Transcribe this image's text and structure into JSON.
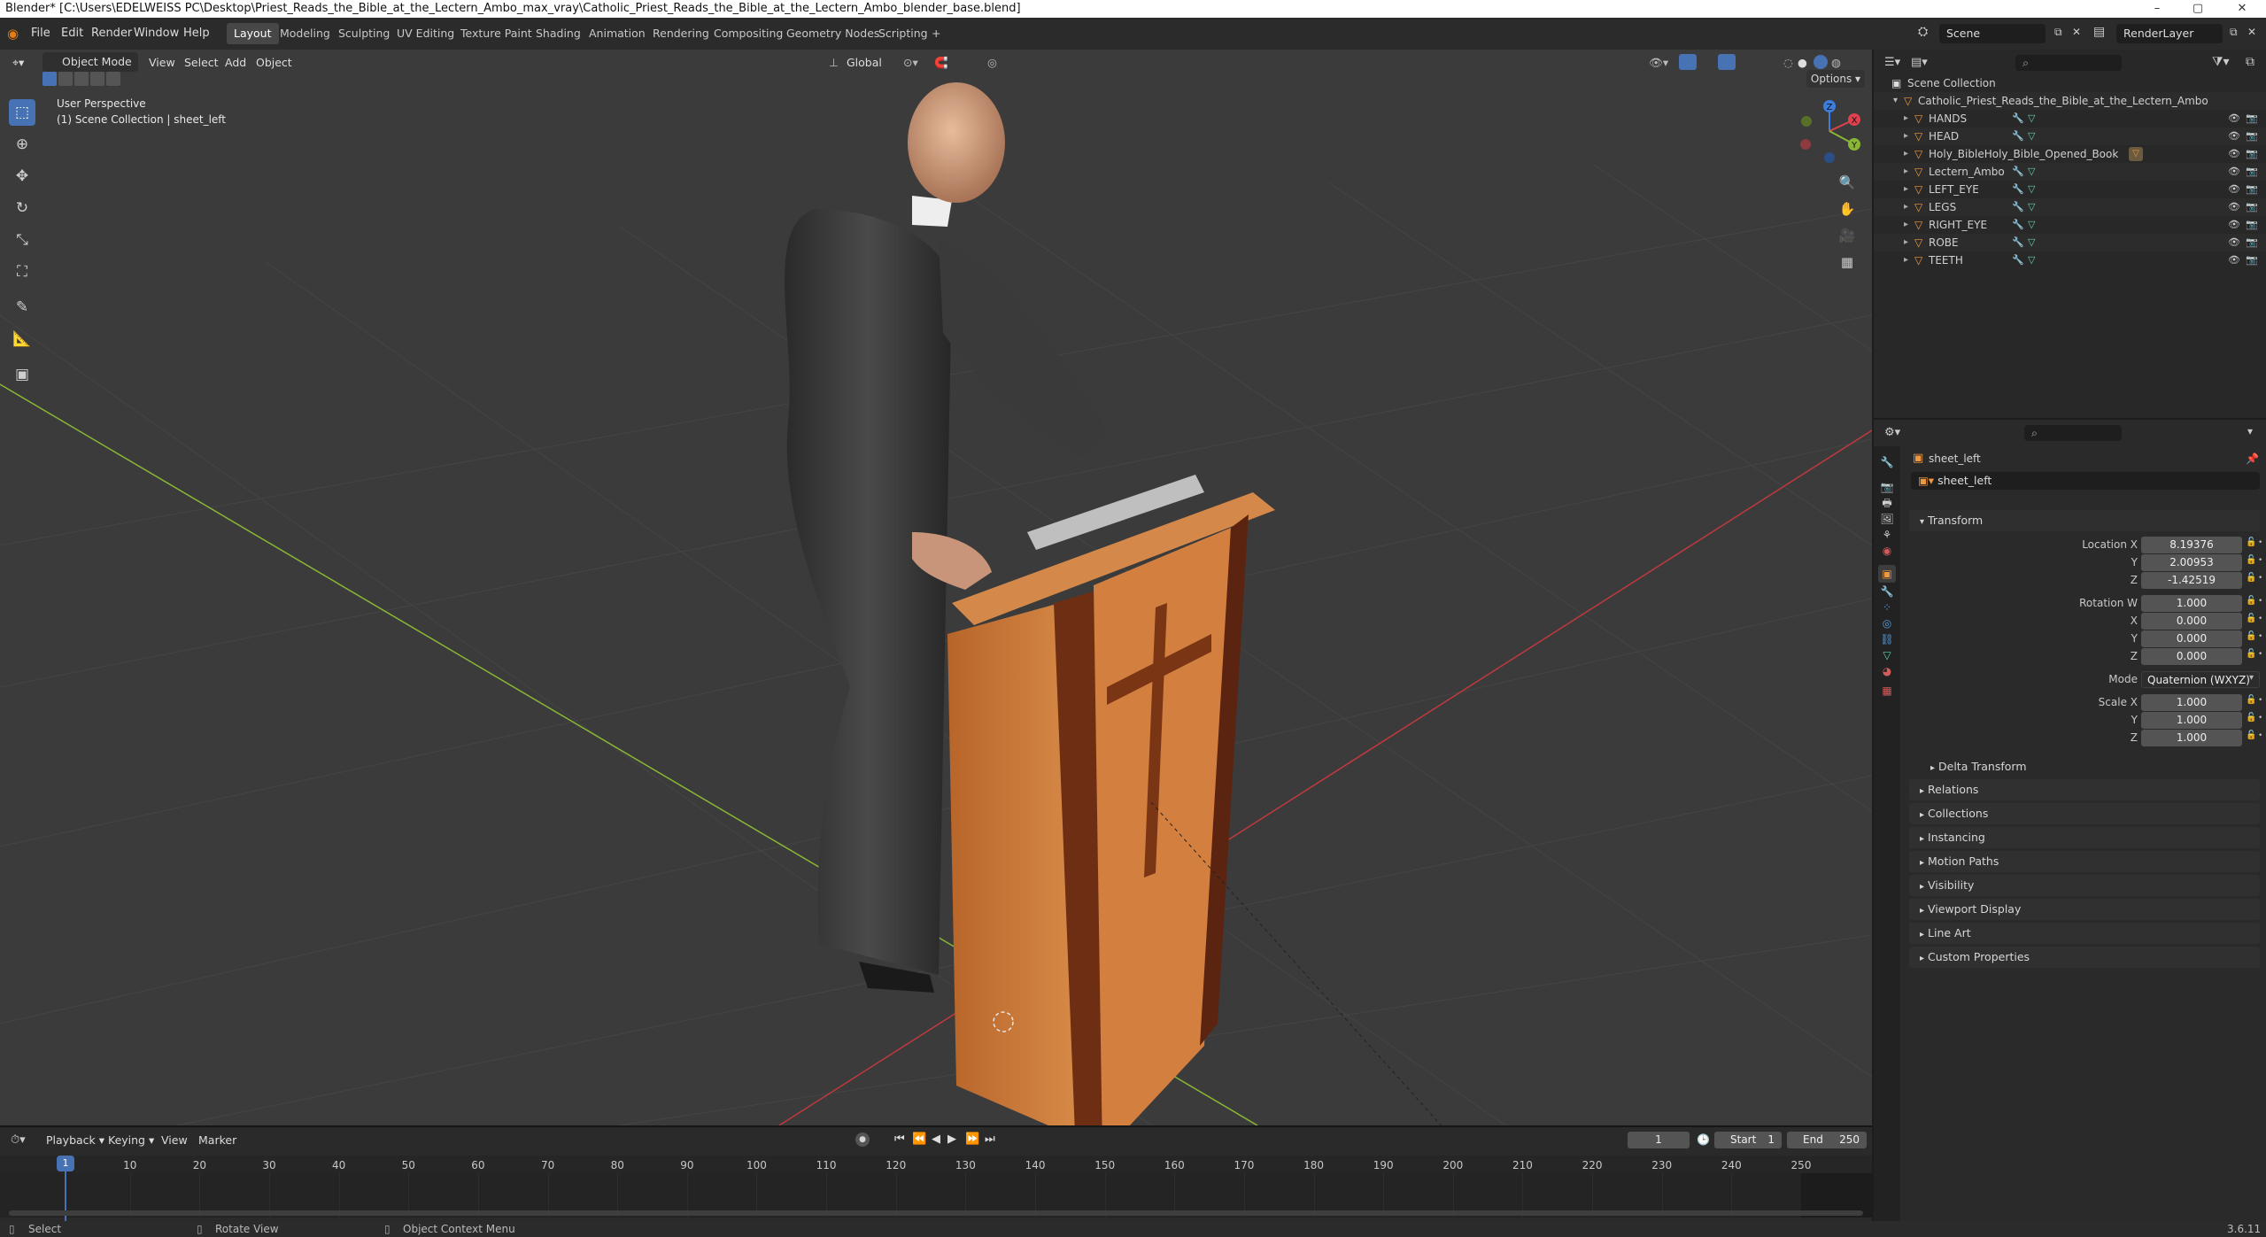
{
  "window": {
    "title": "Blender* [C:\\Users\\EDELWEISS PC\\Desktop\\Priest_Reads_the_Bible_at_the_Lectern_Ambo_max_vray\\Catholic_Priest_Reads_the_Bible_at_the_Lectern_Ambo_blender_base.blend]",
    "minimize": "–",
    "maximize": "▢",
    "close": "✕"
  },
  "menus": [
    "File",
    "Edit",
    "Render",
    "Window",
    "Help"
  ],
  "workspaces": [
    "Layout",
    "Modeling",
    "Sculpting",
    "UV Editing",
    "Texture Paint",
    "Shading",
    "Animation",
    "Rendering",
    "Compositing",
    "Geometry Nodes",
    "Scripting",
    "+"
  ],
  "scene": {
    "name": "Scene",
    "render_layer": "RenderLayer"
  },
  "viewport": {
    "mode": "Object Mode",
    "menus": [
      "View",
      "Select",
      "Add",
      "Object"
    ],
    "orientation": "Global",
    "options": "Options",
    "info_line1": "User Perspective",
    "info_line2": "(1) Scene Collection | sheet_left",
    "gizmo": {
      "x": "X",
      "y": "Y",
      "z": "Z"
    }
  },
  "outliner": {
    "root": "Scene Collection",
    "collection": "Catholic_Priest_Reads_the_Bible_at_the_Lectern_Ambo",
    "objects": [
      "HANDS",
      "HEAD",
      "Holy_BibleHoly_Bible_Opened_Book",
      "Lectern_Ambo",
      "LEFT_EYE",
      "LEGS",
      "RIGHT_EYE",
      "ROBE",
      "TEETH"
    ]
  },
  "properties": {
    "object_name": "sheet_left",
    "data_name": "sheet_left",
    "transform_label": "Transform",
    "location": {
      "label_x": "Location X",
      "x": "8.19376",
      "y": "2.00953",
      "z": "-1.42519"
    },
    "rotation": {
      "label_w": "Rotation W",
      "w": "1.000",
      "x": "0.000",
      "y": "0.000",
      "z": "0.000"
    },
    "mode_label": "Mode",
    "mode_value": "Quaternion (WXYZ)",
    "scale": {
      "label_x": "Scale X",
      "x": "1.000",
      "y": "1.000",
      "z": "1.000"
    },
    "axis_labels": {
      "x": "X",
      "y": "Y",
      "z": "Z"
    },
    "delta_transform": "Delta Transform",
    "sections": [
      "Relations",
      "Collections",
      "Instancing",
      "Motion Paths",
      "Visibility",
      "Viewport Display",
      "Line Art",
      "Custom Properties"
    ]
  },
  "timeline": {
    "menus": [
      "Playback",
      "Keying",
      "View",
      "Marker"
    ],
    "current_frame": "1",
    "start_label": "Start",
    "start": "1",
    "end_label": "End",
    "end": "250",
    "ticks": [
      "1",
      "10",
      "20",
      "30",
      "40",
      "50",
      "60",
      "70",
      "80",
      "90",
      "100",
      "110",
      "120",
      "130",
      "140",
      "150",
      "160",
      "170",
      "180",
      "190",
      "200",
      "210",
      "220",
      "230",
      "240",
      "250"
    ]
  },
  "status": {
    "select": "Select",
    "rotate": "Rotate View",
    "context": "Object Context Menu",
    "version": "3.6.11"
  },
  "colors": {
    "accent": "#4772b3",
    "x_axis": "#e0414f",
    "y_axis": "#8ab635",
    "z_axis": "#3b7ee0",
    "object_orange": "#f0983f",
    "mesh_green": "#5fd0a8"
  }
}
